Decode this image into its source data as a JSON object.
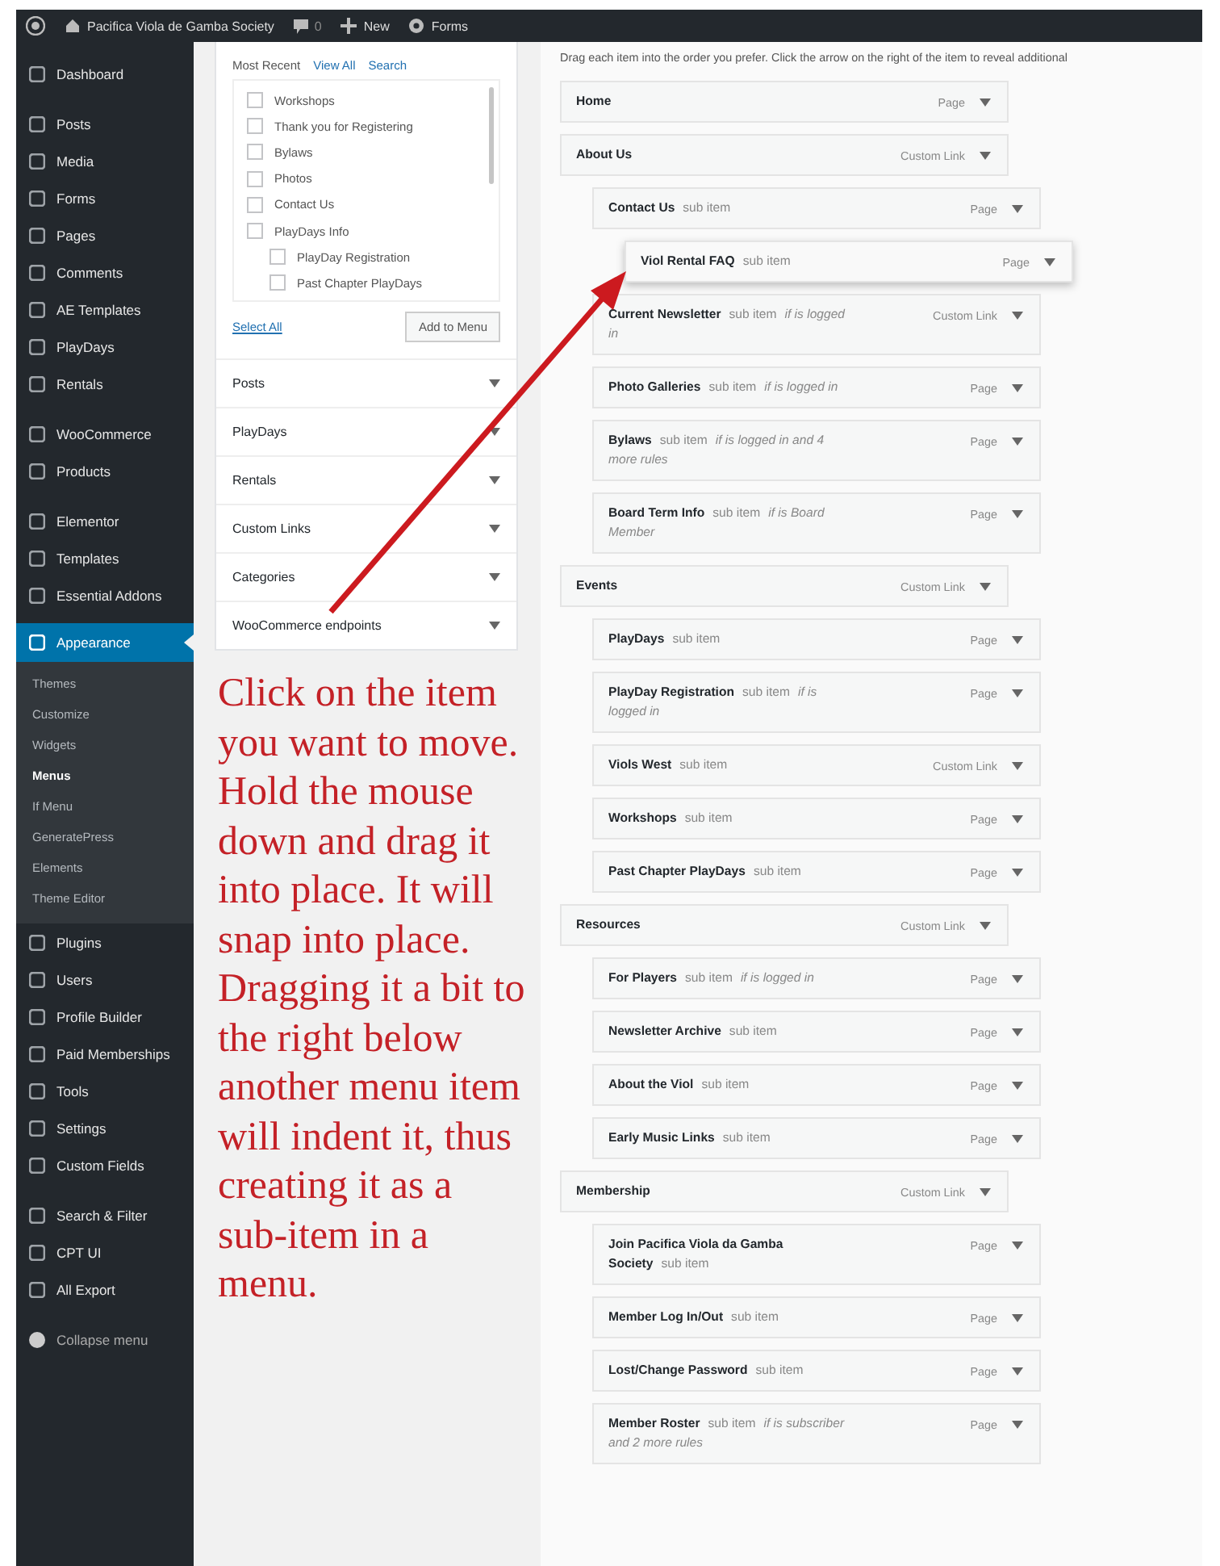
{
  "top_bar": {
    "site_name": "Pacifica Viola de Gamba Society",
    "comments": "0",
    "new_label": "New",
    "forms_label": "Forms"
  },
  "sidebar": {
    "sections": [
      {
        "items": [
          {
            "label": "Dashboard",
            "selected": false
          }
        ]
      },
      {
        "items": [
          {
            "label": "Posts",
            "selected": false
          },
          {
            "label": "Media",
            "selected": false
          },
          {
            "label": "Forms",
            "selected": false
          },
          {
            "label": "Pages",
            "selected": false
          },
          {
            "label": "Comments",
            "selected": false
          },
          {
            "label": "AE Templates",
            "selected": false
          },
          {
            "label": "PlayDays",
            "selected": false
          },
          {
            "label": "Rentals",
            "selected": false
          }
        ]
      },
      {
        "items": [
          {
            "label": "WooCommerce",
            "selected": false
          },
          {
            "label": "Products",
            "selected": false
          }
        ]
      },
      {
        "items": [
          {
            "label": "Elementor",
            "selected": false
          },
          {
            "label": "Templates",
            "selected": false
          },
          {
            "label": "Essential Addons",
            "selected": false
          },
          {
            "label": "Appearance",
            "selected": true,
            "children": [
              {
                "label": "Themes",
                "selected": false
              },
              {
                "label": "Customize",
                "selected": false
              },
              {
                "label": "Widgets",
                "selected": false
              },
              {
                "label": "Menus",
                "selected": true
              },
              {
                "label": "If Menu",
                "selected": false
              },
              {
                "label": "GeneratePress",
                "selected": false
              },
              {
                "label": "Elements",
                "selected": false
              },
              {
                "label": "Theme Editor",
                "selected": false
              }
            ]
          },
          {
            "label": "Plugins",
            "selected": false
          },
          {
            "label": "Users",
            "selected": false
          },
          {
            "label": "Profile Builder",
            "selected": false
          },
          {
            "label": "Paid Memberships",
            "selected": false
          },
          {
            "label": "Tools",
            "selected": false
          },
          {
            "label": "Settings",
            "selected": false
          },
          {
            "label": "Custom Fields",
            "selected": false
          }
        ]
      },
      {
        "items": [
          {
            "label": "Search & Filter",
            "selected": false
          },
          {
            "label": "CPT UI",
            "selected": false
          },
          {
            "label": "All Export",
            "selected": false
          }
        ]
      }
    ],
    "collapse_label": "Collapse menu"
  },
  "add_menu_items": {
    "tabs": [
      {
        "label": "Most Recent",
        "selected": true
      },
      {
        "label": "View All",
        "selected": false
      },
      {
        "label": "Search",
        "selected": false
      }
    ],
    "pages": [
      {
        "label": "Workshops",
        "checked": false
      },
      {
        "label": "Thank you for Registering",
        "checked": false
      },
      {
        "label": "Bylaws",
        "checked": false
      },
      {
        "label": "Photos",
        "checked": false
      },
      {
        "label": "Contact Us",
        "checked": false
      },
      {
        "label": "PlayDays Info",
        "checked": false,
        "children": [
          {
            "label": "PlayDay Registration",
            "checked": false
          },
          {
            "label": "Past Chapter PlayDays",
            "checked": false
          }
        ]
      }
    ],
    "select_all": "Select All",
    "add_button": "Add to Menu",
    "sections": [
      {
        "label": "Posts"
      },
      {
        "label": "PlayDays"
      },
      {
        "label": "Rentals"
      },
      {
        "label": "Custom Links"
      },
      {
        "label": "Categories"
      },
      {
        "label": "WooCommerce endpoints"
      }
    ]
  },
  "annotation": {
    "text": "Click on the item you want to move. Hold the mouse down and drag it into place. It will snap into place. Dragging it a bit to the right below another menu item will indent it, thus creating it as a sub-item in a menu."
  },
  "menu_structure": {
    "instructions": "Drag each item into the order you prefer. Click the arrow on the right of the item to reveal additional",
    "items": [
      {
        "title": "Home",
        "type": "Page",
        "dragging": false
      },
      {
        "title": "About Us",
        "type": "Custom Link",
        "dragging": false,
        "children": [
          {
            "title": "Contact Us",
            "sub_label": "sub item",
            "type": "Page",
            "dragging": false,
            "children": [
              {
                "title": "Viol Rental FAQ",
                "sub_label": "sub item",
                "type": "Page",
                "dragging": true
              }
            ]
          },
          {
            "title": "Current Newsletter",
            "sub_label": "sub item",
            "note": "if is logged in",
            "type": "Custom Link",
            "dragging": false
          },
          {
            "title": "Photo Galleries",
            "sub_label": "sub item",
            "note": "if is logged in",
            "type": "Page",
            "dragging": false
          },
          {
            "title": "Bylaws",
            "sub_label": "sub item",
            "note": "if is logged in and 4 more rules",
            "type": "Page",
            "dragging": false
          },
          {
            "title": "Board Term Info",
            "sub_label": "sub item",
            "note": "if is Board Member",
            "type": "Page",
            "dragging": false
          }
        ]
      },
      {
        "title": "Events",
        "type": "Custom Link",
        "dragging": false,
        "children": [
          {
            "title": "PlayDays",
            "sub_label": "sub item",
            "type": "Page",
            "dragging": false
          },
          {
            "title": "PlayDay Registration",
            "sub_label": "sub item",
            "note": "if is logged in",
            "type": "Page",
            "dragging": false
          },
          {
            "title": "Viols West",
            "sub_label": "sub item",
            "type": "Custom Link",
            "dragging": false
          },
          {
            "title": "Workshops",
            "sub_label": "sub item",
            "type": "Page",
            "dragging": false
          },
          {
            "title": "Past Chapter PlayDays",
            "sub_label": "sub item",
            "type": "Page",
            "dragging": false
          }
        ]
      },
      {
        "title": "Resources",
        "type": "Custom Link",
        "dragging": false,
        "children": [
          {
            "title": "For Players",
            "sub_label": "sub item",
            "note": "if is logged in",
            "type": "Page",
            "dragging": false
          },
          {
            "title": "Newsletter Archive",
            "sub_label": "sub item",
            "type": "Page",
            "dragging": false
          },
          {
            "title": "About the Viol",
            "sub_label": "sub item",
            "type": "Page",
            "dragging": false
          },
          {
            "title": "Early Music Links",
            "sub_label": "sub item",
            "type": "Page",
            "dragging": false
          }
        ]
      },
      {
        "title": "Membership",
        "type": "Custom Link",
        "dragging": false,
        "children": [
          {
            "title": "Join Pacifica Viola da Gamba Society",
            "sub_label": "sub item",
            "type": "Page",
            "dragging": false
          },
          {
            "title": "Member Log In/Out",
            "sub_label": "sub item",
            "type": "Page",
            "dragging": false
          },
          {
            "title": "Lost/Change Password",
            "sub_label": "sub item",
            "type": "Page",
            "dragging": false
          },
          {
            "title": "Member Roster",
            "sub_label": "sub item",
            "note": "if is subscriber and 2 more rules",
            "type": "Page",
            "dragging": false
          }
        ]
      }
    ]
  }
}
